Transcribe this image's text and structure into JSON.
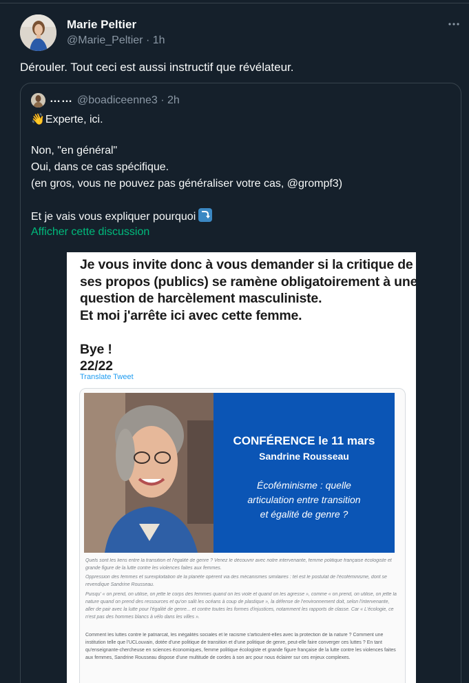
{
  "tweet": {
    "author_name": "Marie Peltier",
    "handle_time": "@Marie_Peltier · 1h",
    "text": "Dérouler. Tout ceci est aussi instructif que révélateur."
  },
  "quoted": {
    "name": "……",
    "handle_time": "@boadiceenne3 · 2h",
    "line1": "Experte, ici.",
    "line2": "Non, \"en général\"",
    "line3": "Oui, dans ce cas spécifique.",
    "line4": "(en gros, vous ne pouvez pas généraliser votre cas, @grompf3)",
    "line5": "Et je vais vous expliquer pourquoi",
    "show_thread": "Afficher cette discussion",
    "emoji_wave": "👋"
  },
  "screenshot": {
    "lines": [
      "Je vous invite donc à vous demander si la critique de",
      "ses propos (publics) se ramène obligatoirement à une",
      "question de harcèlement masculiniste.",
      "Et moi j'arrête ici avec cette femme.",
      "",
      "Bye !",
      "22/22"
    ],
    "translate": "Translate Tweet",
    "card": {
      "conf_title": "CONFÉRENCE le 11 mars",
      "conf_name": "Sandrine Rousseau",
      "conf_sub1": "Écoféminisme : quelle",
      "conf_sub2": "articulation entre transition",
      "conf_sub3": "et égalité de genre ?",
      "para1": "Quels sont les liens entre la transition et l'égalité de genre ? Venez le découvrir avec notre intervenante, femme politique française écologiste et grande figure de la lutte contre les violences faites aux femmes.",
      "para2": "Oppression des femmes et surexploitation de la planète opèrent via des mécanismes similaires : tel est le postulat de l'écoféminisme, dont se revendique Sandrine Rousseau.",
      "para3": "Puisqu' « on prend, on utilise, on jette le corps des femmes quand on les viole et quand on les agresse », comme « on prend, on utilise, on jette la nature quand on prend des ressources et qu'on salit les océans à coup de plastique », la défense de l'environnement doit, selon l'intervenante, aller de pair avec la lutte pour l'égalité de genre... et contre toutes les formes d'injustices, notamment les rapports de classe. Car « L'écologie, ce n'est pas des hommes blancs à vélo dans les villes ».",
      "para4": "Comment les luttes contre le patriarcat, les inégalités sociales et le racisme s'articulent-elles avec la protection de la nature ? Comment une institution telle que l'UCLouvain, dotée d'une politique de transition et d'une politique de genre, peut-elle faire converger ces luttes ? En tant qu'enseignante-chercheuse en sciences économiques, femme politique écologiste et grande figure française de la lutte contre les violences faites aux femmes, Sandrine Rousseau dispose d'une multitude de cordes à son arc pour nous éclairer sur ces enjeux complexes."
    }
  },
  "colors": {
    "background": "#15202b",
    "text": "#f7f9f9",
    "muted": "#8b98a5",
    "link_green": "#00ba7c",
    "border": "#38444d",
    "conf_blue": "#0b55b5"
  }
}
